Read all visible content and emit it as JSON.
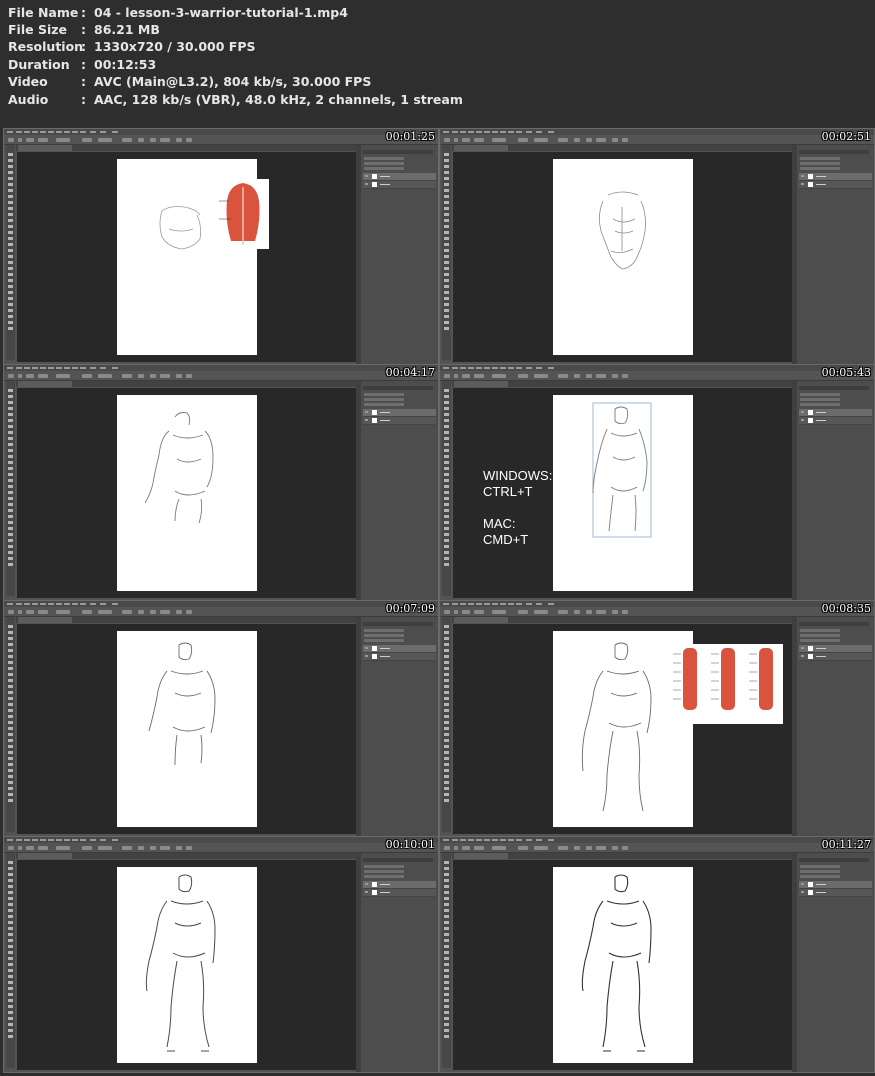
{
  "info": [
    {
      "label": "File Name",
      "value": "04 - lesson-3-warrior-tutorial-1.mp4"
    },
    {
      "label": "File Size",
      "value": "86.21 MB"
    },
    {
      "label": "Resolution",
      "value": "1330x720 / 30.000 FPS"
    },
    {
      "label": "Duration",
      "value": "00:12:53"
    },
    {
      "label": "Video",
      "value": "AVC (Main@L3.2), 804 kb/s, 30.000 FPS"
    },
    {
      "label": "Audio",
      "value": "AAC, 128 kb/s (VBR), 48.0 kHz, 2 channels, 1 stream"
    }
  ],
  "separator": ":",
  "frames": [
    {
      "timestamp": "00:01:25"
    },
    {
      "timestamp": "00:02:51"
    },
    {
      "timestamp": "00:04:17"
    },
    {
      "timestamp": "00:05:43",
      "shortcut": {
        "windows_label": "WINDOWS:",
        "windows_keys": "CTRL+T",
        "mac_label": "MAC:",
        "mac_keys": "CMD+T"
      }
    },
    {
      "timestamp": "00:07:09"
    },
    {
      "timestamp": "00:08:35"
    },
    {
      "timestamp": "00:10:01"
    },
    {
      "timestamp": "00:11:27"
    }
  ],
  "colors": {
    "muscle": "#d9533e",
    "panel": "#535353",
    "canvas_bg": "#282828"
  }
}
